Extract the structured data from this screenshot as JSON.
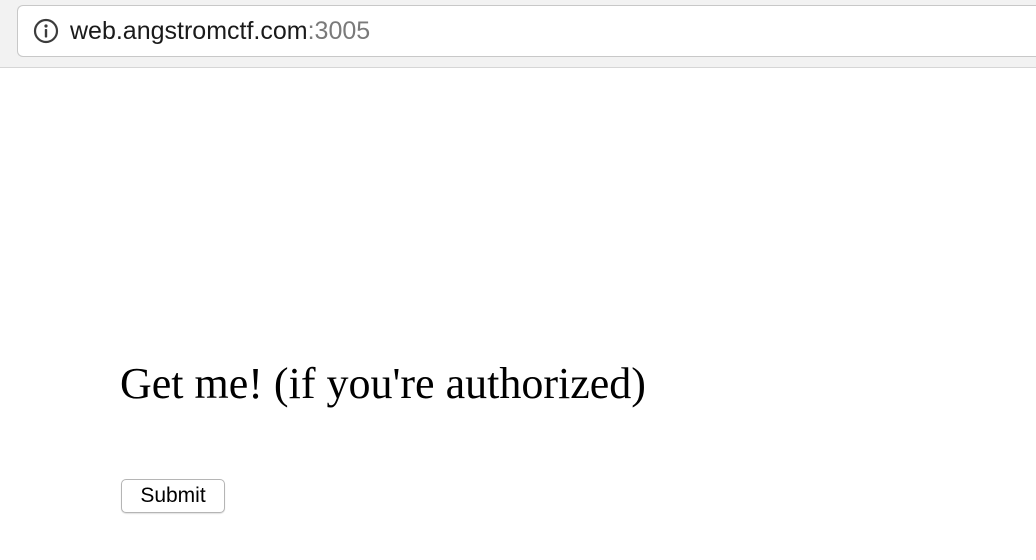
{
  "browser": {
    "address_bar": {
      "icon": "info-icon",
      "url_host": "web.angstromctf.com",
      "url_port": ":3005"
    }
  },
  "page": {
    "heading": "Get me! (if you're authorized)",
    "submit_label": "Submit"
  }
}
